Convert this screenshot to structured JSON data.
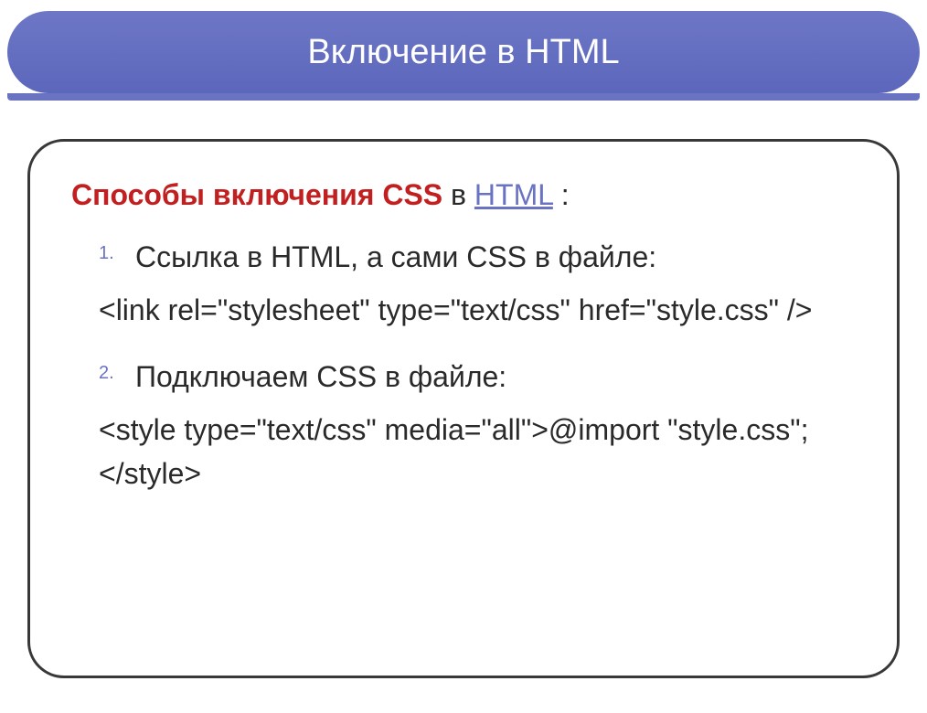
{
  "header": {
    "title": "Включение в HTML"
  },
  "content": {
    "intro_red": "Способы включения CSS",
    "intro_mid": " в ",
    "intro_link": "HTML",
    "intro_end": " :",
    "item1_number": "1.",
    "item1_text": "Ссылка в HTML, а сами CSS в файле:",
    "code1": "<link rel=\"stylesheet\" type=\"text/css\" href=\"style.css\" />",
    "item2_number": "2.",
    "item2_text": "Подключаем CSS в файле:",
    "code2": "<style type=\"text/css\" media=\"all\">@import \"style.css\";</style>"
  }
}
